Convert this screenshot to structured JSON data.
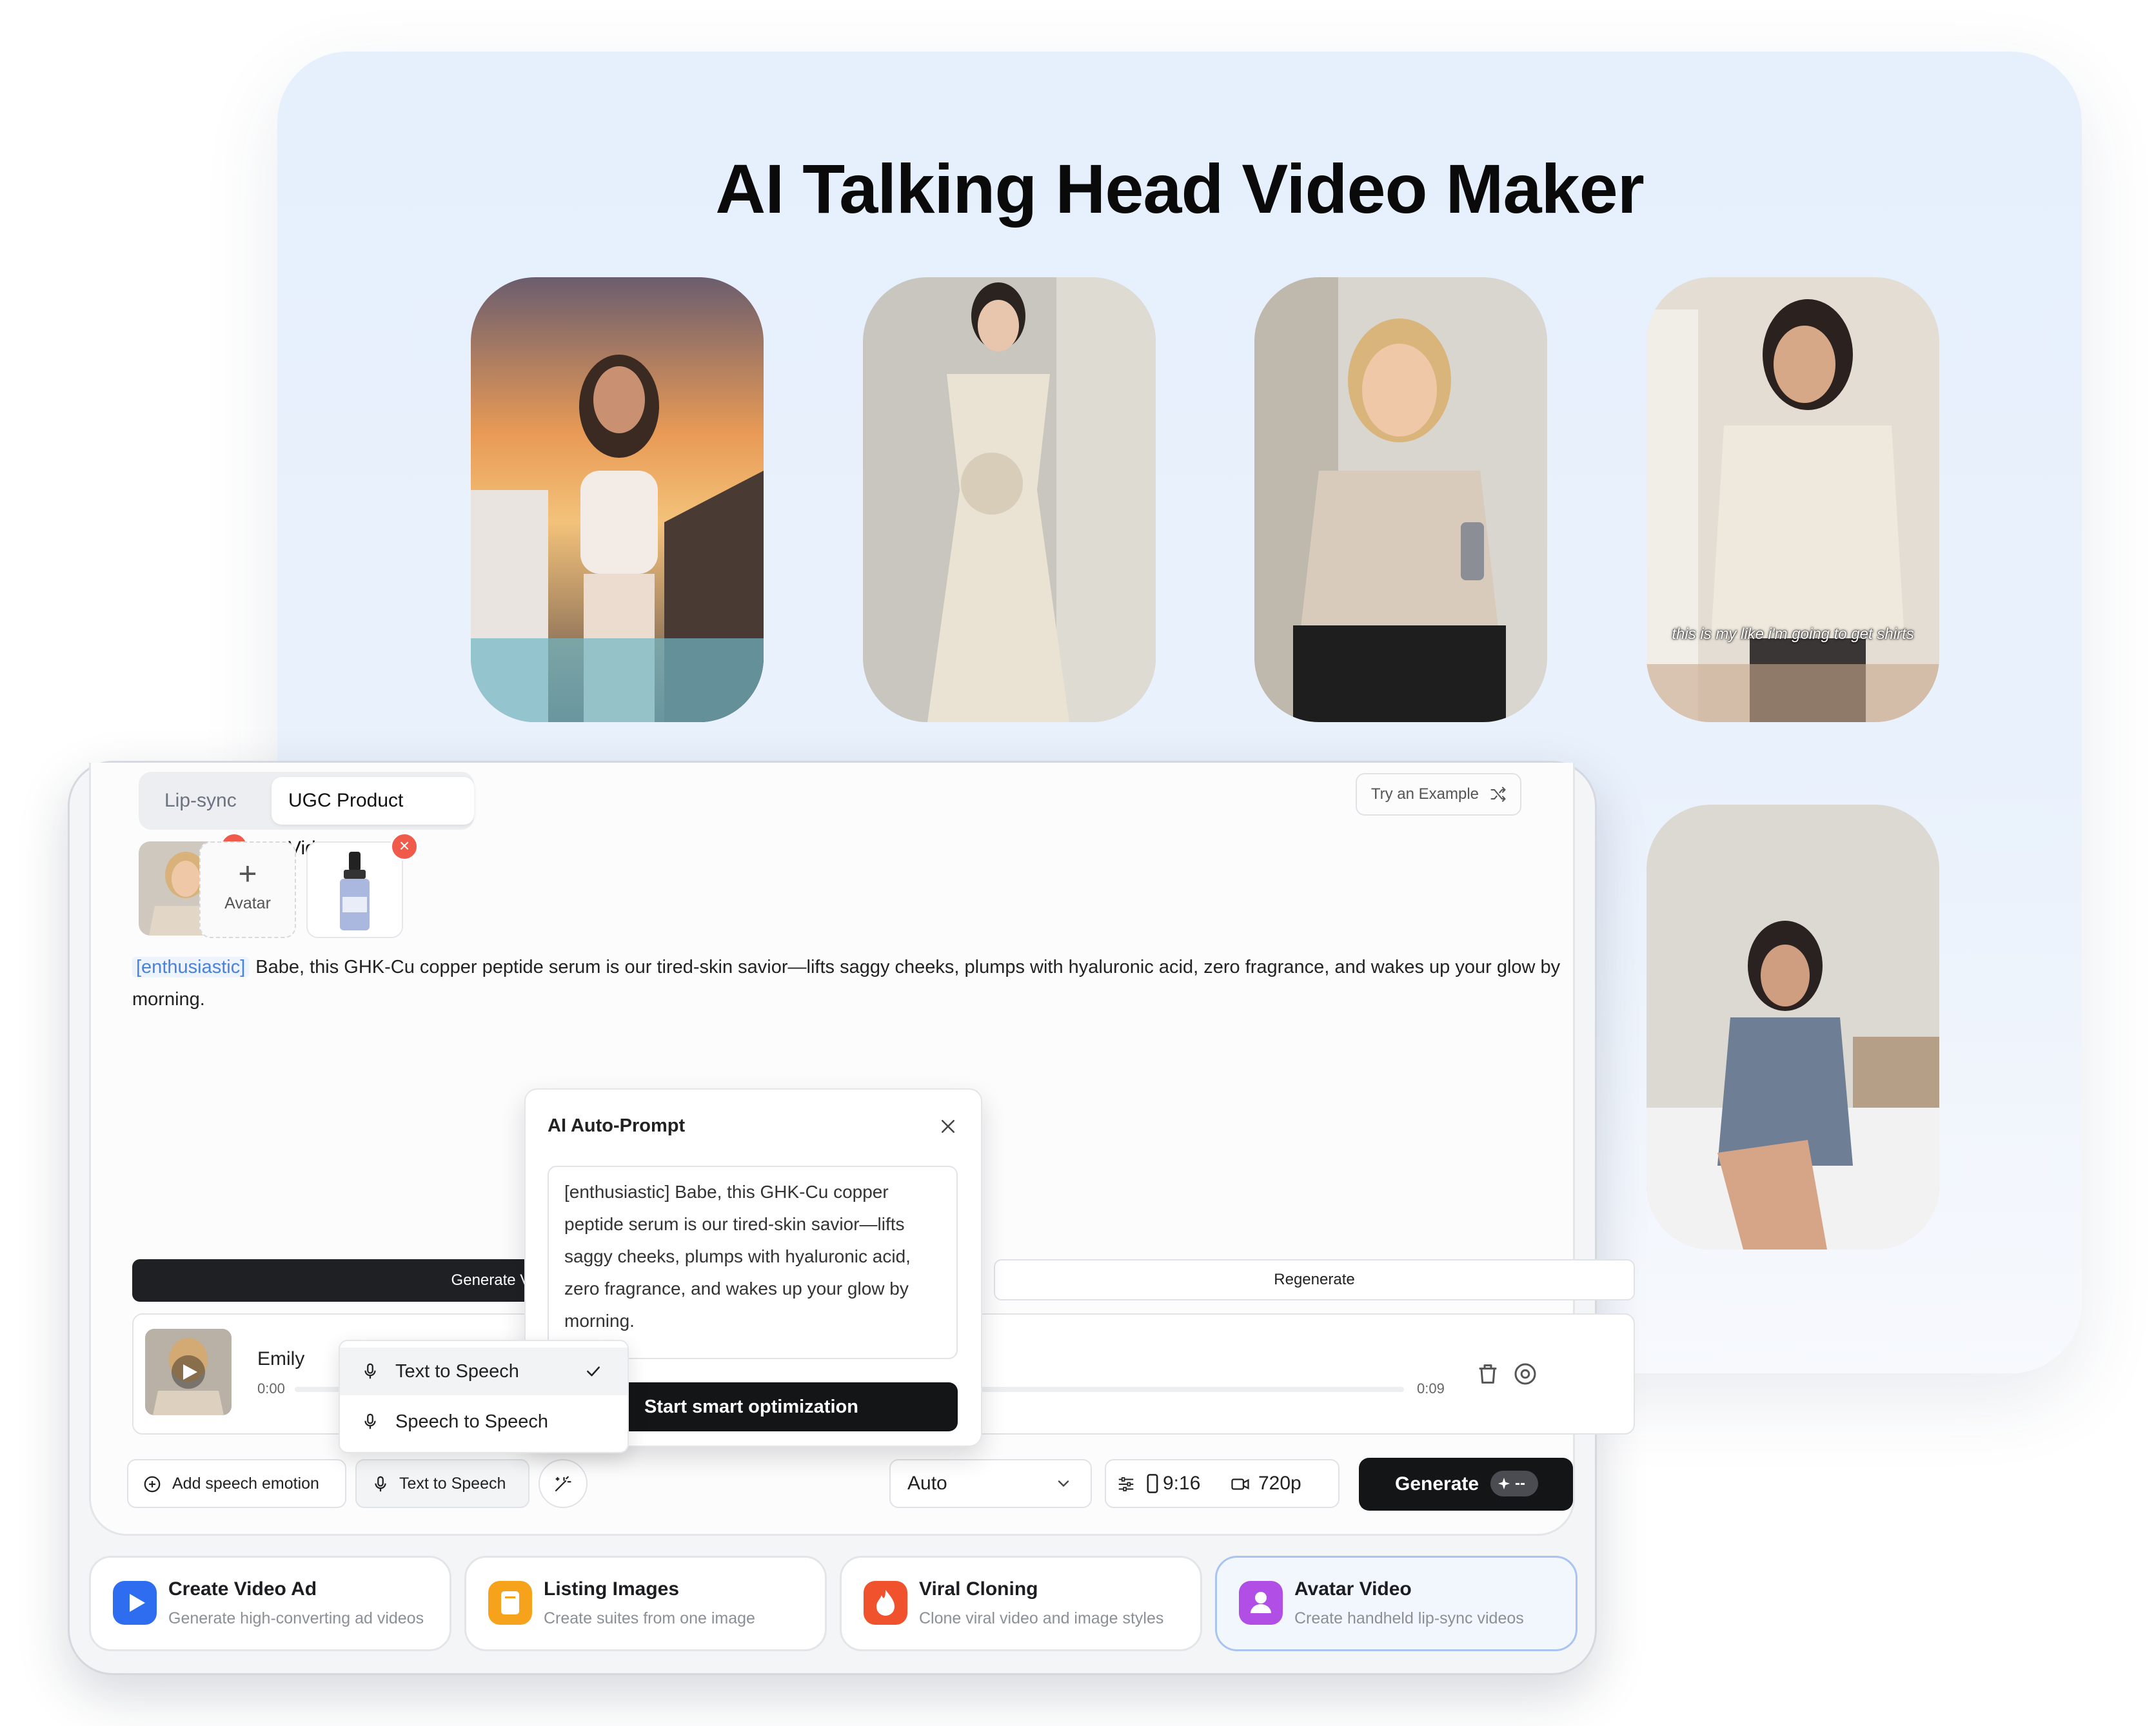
{
  "hero": {
    "title": "AI Talking Head Video Maker",
    "video_caption": "this is my like i'm going to get shirts"
  },
  "tabs": [
    "Lip-sync",
    "UGC Product Video"
  ],
  "try_example": "Try an Example",
  "add_avatar_label": "Avatar",
  "script": {
    "emotion_tag": "[enthusiastic]",
    "text": "Babe, this GHK-Cu copper peptide serum is our tired-skin savior—lifts saggy cheeks, plumps with hyaluronic acid, zero fragrance, and wakes up your glow by morning."
  },
  "generate_voice": "Generate Voice",
  "regenerate": "Regenerate",
  "voice": {
    "name": "Emily",
    "time_start": "0:00",
    "time_end": "0:09"
  },
  "voice_mode_menu": {
    "items": [
      "Text to Speech",
      "Speech to Speech"
    ],
    "selected": "Text to Speech"
  },
  "auto_prompt": {
    "title": "AI Auto-Prompt",
    "text": "[enthusiastic] Babe, this GHK-Cu copper peptide serum is our tired-skin savior—lifts saggy cheeks, plumps with hyaluronic acid, zero fragrance, and wakes up your glow by morning.",
    "button": "Start smart optimization"
  },
  "toolbar": {
    "add_emotion": "Add speech emotion",
    "voice_mode": "Text to Speech",
    "model_select": "Auto",
    "aspect_ratio": "9:16",
    "resolution": "720p",
    "generate": "Generate",
    "credits": "--"
  },
  "features": [
    {
      "title": "Create Video Ad",
      "subtitle": "Generate high-converting ad videos",
      "color": "#2f6df0"
    },
    {
      "title": "Listing Images",
      "subtitle": "Create suites from one image",
      "color": "#f6a21b"
    },
    {
      "title": "Viral Cloning",
      "subtitle": "Clone viral video and image styles",
      "color": "#f0522e"
    },
    {
      "title": "Avatar Video",
      "subtitle": "Create handheld lip-sync videos",
      "color": "#b04ee6"
    }
  ],
  "colors": {
    "accent_blue": "#4a82d8",
    "remove_red": "#ef5a4a",
    "dark_button": "#141517"
  }
}
